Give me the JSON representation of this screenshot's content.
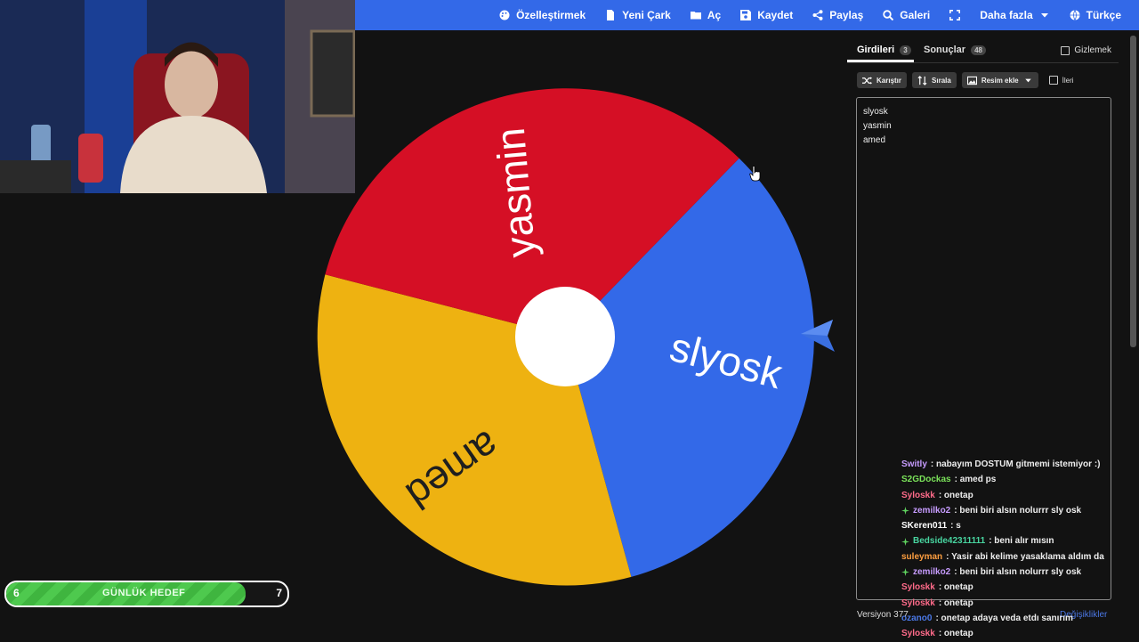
{
  "topnav": [
    {
      "label": "Özelleştirmek",
      "icon": "palette-icon"
    },
    {
      "label": "Yeni Çark",
      "icon": "file-icon"
    },
    {
      "label": "Aç",
      "icon": "folder-icon"
    },
    {
      "label": "Kaydet",
      "icon": "save-icon"
    },
    {
      "label": "Paylaş",
      "icon": "share-icon"
    },
    {
      "label": "Galeri",
      "icon": "search-icon"
    },
    {
      "label": "",
      "icon": "fullscreen-icon"
    },
    {
      "label": "Daha fazla",
      "icon": "chevron-down-icon"
    },
    {
      "label": "Türkçe",
      "icon": "globe-icon"
    }
  ],
  "wheel": {
    "segments": [
      {
        "label": "slyosk",
        "color": "#3369e8"
      },
      {
        "label": "amed",
        "color": "#eeb211"
      },
      {
        "label": "yasmin",
        "color": "#d50f25"
      }
    ],
    "center_color": "#ffffff"
  },
  "panel": {
    "tabs": [
      {
        "label": "Girdileri",
        "count": "3"
      },
      {
        "label": "Sonuçlar",
        "count": "48"
      }
    ],
    "hide_label": "Gizlemek",
    "toolbar": {
      "shuffle": "Karıştır",
      "sort": "Sırala",
      "add_image": "Resim ekle",
      "advanced": "İleri"
    },
    "entries": [
      "slyosk",
      "yasmin",
      "amed"
    ],
    "version": "Versiyon 377",
    "changes": "Değişiklikler"
  },
  "chat": [
    {
      "user": "Switly",
      "color": "#c79cff",
      "text": "nabayım DOSTUM gitmemi istemiyor :)",
      "badge": false
    },
    {
      "user": "S2GDockas",
      "color": "#7be35a",
      "text": "amed ps",
      "badge": false
    },
    {
      "user": "Syloskk",
      "color": "#ff6b8a",
      "text": "onetap",
      "badge": false
    },
    {
      "user": "zemilko2",
      "color": "#c79cff",
      "text": "beni biri alsın nolurrr sly osk",
      "badge": true
    },
    {
      "user": "SKeren011",
      "color": "#ffffff",
      "text": "s",
      "badge": false
    },
    {
      "user": "Bedside42311111",
      "color": "#48d5a0",
      "text": "beni alır mısın",
      "badge": true
    },
    {
      "user": "suleyman",
      "color": "#ff9f40",
      "text": "Yasir abi kelime yasaklama aldım da",
      "badge": false
    },
    {
      "user": "zemilko2",
      "color": "#c79cff",
      "text": "beni biri alsın nolurrr sly osk",
      "badge": true
    },
    {
      "user": "Syloskk",
      "color": "#ff6b8a",
      "text": "onetap",
      "badge": false
    },
    {
      "user": "Syloskk",
      "color": "#ff6b8a",
      "text": "onetap",
      "badge": false
    },
    {
      "user": "ozano0",
      "color": "#4b78e6",
      "text": "onetap adaya veda etdı sanırım",
      "badge": false
    },
    {
      "user": "Syloskk",
      "color": "#ff6b8a",
      "text": "onetap",
      "badge": false
    }
  ],
  "goal": {
    "current": "6",
    "label": "GÜNLÜK HEDEF",
    "target": "7",
    "progress": 0.85
  }
}
